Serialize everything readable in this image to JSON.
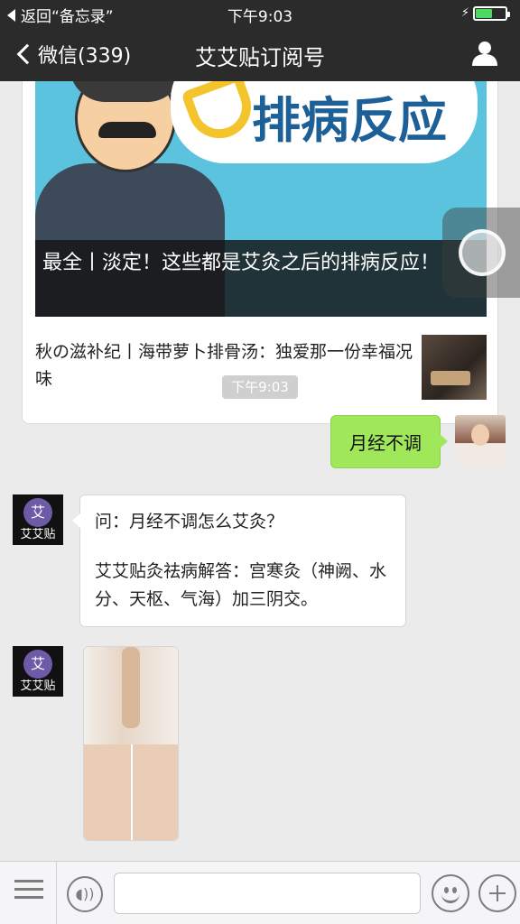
{
  "status_bar": {
    "back_label": "返回“备忘录”",
    "time": "下午9:03",
    "battery_level": 0.55
  },
  "nav": {
    "back_label": "微信(339)",
    "title": "艾艾贴订阅号",
    "user_icon": "user-icon"
  },
  "article_card": {
    "cover_badge_text": "排病反应",
    "cover_caption": "最全丨淡定！这些都是艾灸之后的排病反应！",
    "secondary_title": "秋の滋补纪丨海带萝卜排骨汤：独爱那一份幸福况味"
  },
  "timestamp": "下午9:03",
  "messages": {
    "outgoing_text": "月经不调",
    "bot_name": "艾艾贴",
    "bot_avatar_glyph": "艾",
    "incoming_question": "问：月经不调怎么艾灸？",
    "incoming_answer": "艾艾贴灸祛病解答：宫寒灸（神阙、水分、天枢、气海）加三阴交。"
  },
  "input_bar": {
    "menu_icon": "menu-icon",
    "voice_icon": "voice-icon",
    "emoji_icon": "emoji-icon",
    "plus_icon": "plus-icon"
  },
  "colors": {
    "bar_bg": "#2b2b2b",
    "chat_bg": "#ebebeb",
    "outgoing_bubble": "#a0e75a",
    "timestamp_bg": "#cfcfcf",
    "battery_green": "#4cd964"
  }
}
